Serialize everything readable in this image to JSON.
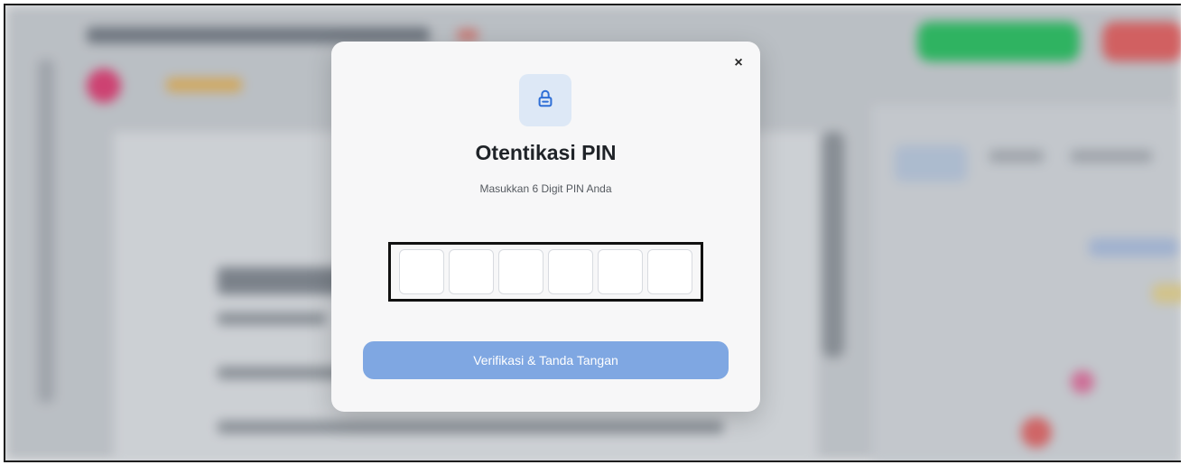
{
  "modal": {
    "title": "Otentikasi PIN",
    "subtitle": "Masukkan 6 Digit PIN Anda",
    "close_label": "×",
    "pin_cells": [
      "",
      "",
      "",
      "",
      "",
      ""
    ],
    "verify_button_label": "Verifikasi & Tanda Tangan",
    "lock_icon": "lock-icon"
  },
  "colors": {
    "accent": "#7fa7e2",
    "lock_bg": "#dde8f6",
    "lock_icon": "#2f6fd6",
    "bg_green_button": "#1fbf5a",
    "bg_red_button": "#e45a5a"
  }
}
